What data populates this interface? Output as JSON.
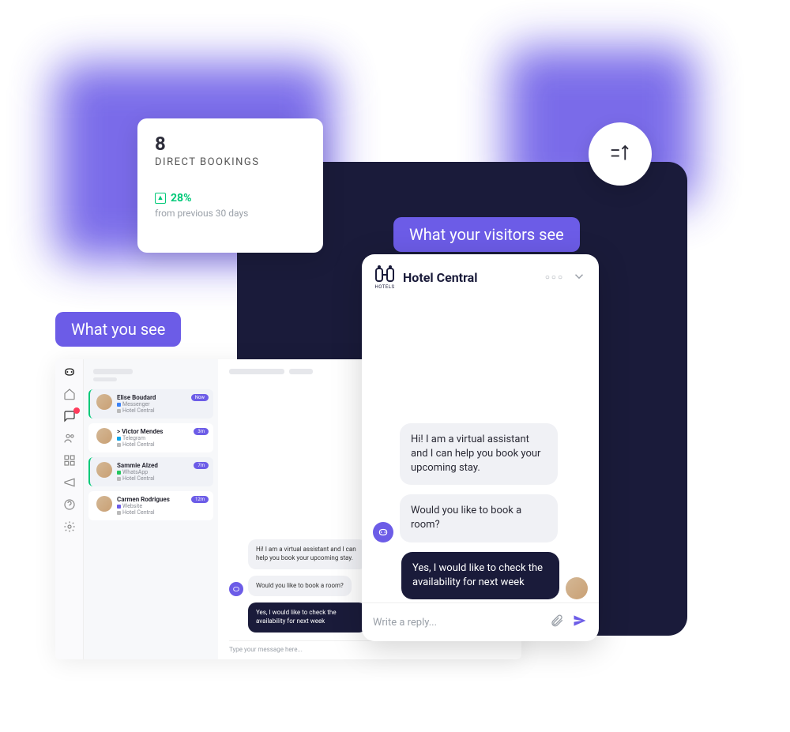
{
  "stats": {
    "value": "8",
    "label": "DIRECT BOOKINGS",
    "trend": "28%",
    "trend_sub": "from previous 30 days"
  },
  "pills": {
    "you": "What you see",
    "visitors": "What your visitors see"
  },
  "agent": {
    "conversations": [
      {
        "name": "Elise Boudard",
        "source": "Messenger",
        "sub": "Hotel Central",
        "time": "Now",
        "selected": true,
        "dot": "#3b82f6"
      },
      {
        "name": "> Victor Mendes",
        "source": "Telegram",
        "sub": "Hotel Central",
        "time": "3m",
        "selected": false,
        "dot": "#0ea5e9"
      },
      {
        "name": "Sammie Alzed",
        "source": "WhatsApp",
        "sub": "Hotel Central",
        "time": "7m",
        "selected": true,
        "dot": "#22c55e"
      },
      {
        "name": "Carmen Rodrigues",
        "source": "Website",
        "sub": "Hotel Central",
        "time": "12m",
        "selected": false,
        "dot": "#6C5CE7"
      }
    ],
    "messages": {
      "bot1": "Hi! I am a virtual assistant and I can help you book your upcoming stay.",
      "bot2": "Would you like to book a room?",
      "user1": "Yes, I would like to check the availability for next week"
    },
    "input_placeholder": "Type your message here..."
  },
  "visitor": {
    "brand": "Hotel Central",
    "brand_logo_label": "HOTELS",
    "messages": {
      "bot1": "Hi! I am a virtual assistant and I can help you book your upcoming stay.",
      "bot2": "Would you like to book a room?",
      "user1": "Yes, I would like to check the availability for next week"
    },
    "input_placeholder": "Write a reply..."
  }
}
